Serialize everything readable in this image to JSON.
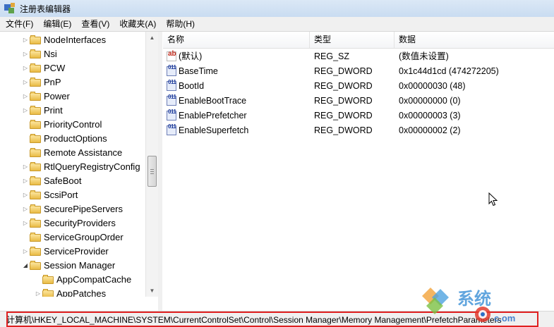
{
  "window": {
    "title": "注册表编辑器"
  },
  "menu": [
    "文件(F)",
    "编辑(E)",
    "查看(V)",
    "收藏夹(A)",
    "帮助(H)"
  ],
  "tree": {
    "items": [
      {
        "label": "NodeInterfaces",
        "arrow": "collapsed",
        "indent": 0
      },
      {
        "label": "Nsi",
        "arrow": "collapsed",
        "indent": 0
      },
      {
        "label": "PCW",
        "arrow": "collapsed",
        "indent": 0
      },
      {
        "label": "PnP",
        "arrow": "collapsed",
        "indent": 0
      },
      {
        "label": "Power",
        "arrow": "collapsed",
        "indent": 0
      },
      {
        "label": "Print",
        "arrow": "collapsed",
        "indent": 0
      },
      {
        "label": "PriorityControl",
        "arrow": "none",
        "indent": 0
      },
      {
        "label": "ProductOptions",
        "arrow": "none",
        "indent": 0
      },
      {
        "label": "Remote Assistance",
        "arrow": "none",
        "indent": 0
      },
      {
        "label": "RtlQueryRegistryConfig",
        "arrow": "collapsed",
        "indent": 0
      },
      {
        "label": "SafeBoot",
        "arrow": "collapsed",
        "indent": 0
      },
      {
        "label": "ScsiPort",
        "arrow": "collapsed",
        "indent": 0
      },
      {
        "label": "SecurePipeServers",
        "arrow": "collapsed",
        "indent": 0
      },
      {
        "label": "SecurityProviders",
        "arrow": "collapsed",
        "indent": 0
      },
      {
        "label": "ServiceGroupOrder",
        "arrow": "none",
        "indent": 0
      },
      {
        "label": "ServiceProvider",
        "arrow": "collapsed",
        "indent": 0
      },
      {
        "label": "Session Manager",
        "arrow": "expanded",
        "indent": 0
      },
      {
        "label": "AppCompatCache",
        "arrow": "none",
        "indent": 1
      },
      {
        "label": "AppPatches",
        "arrow": "collapsed",
        "indent": 1
      }
    ]
  },
  "list": {
    "columns": [
      "名称",
      "类型",
      "数据"
    ],
    "rows": [
      {
        "name": "(默认)",
        "type": "REG_SZ",
        "data": "(数值未设置)",
        "icon": "string-value-icon"
      },
      {
        "name": "BaseTime",
        "type": "REG_DWORD",
        "data": "0x1c44d1cd (474272205)",
        "icon": "binary-value-icon"
      },
      {
        "name": "BootId",
        "type": "REG_DWORD",
        "data": "0x00000030 (48)",
        "icon": "binary-value-icon"
      },
      {
        "name": "EnableBootTrace",
        "type": "REG_DWORD",
        "data": "0x00000000 (0)",
        "icon": "binary-value-icon"
      },
      {
        "name": "EnablePrefetcher",
        "type": "REG_DWORD",
        "data": "0x00000003 (3)",
        "icon": "binary-value-icon"
      },
      {
        "name": "EnableSuperfetch",
        "type": "REG_DWORD",
        "data": "0x00000002 (2)",
        "icon": "binary-value-icon"
      }
    ]
  },
  "status": {
    "path": "计算机\\HKEY_LOCAL_MACHINE\\SYSTEM\\CurrentControlSet\\Control\\Session Manager\\Memory Management\\PrefetchParameters"
  },
  "colors": {
    "highlight_box": "#e02020",
    "folder": "#e9bb45"
  }
}
